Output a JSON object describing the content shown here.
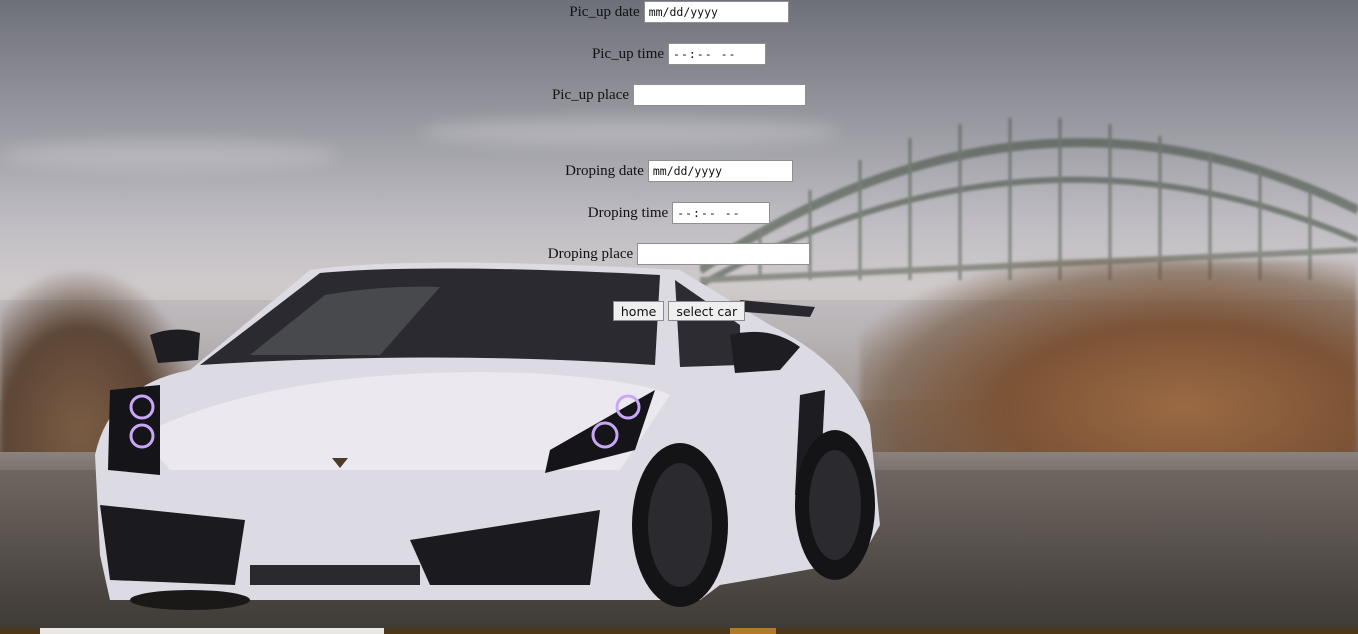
{
  "form": {
    "pickup_date": {
      "label": "Pic_up date",
      "value": "mm/dd/yyyy"
    },
    "pickup_time": {
      "label": "Pic_up time",
      "value": "--:-- --"
    },
    "pickup_place": {
      "label": "Pic_up place",
      "value": ""
    },
    "drop_date": {
      "label": "Droping date",
      "value": "mm/dd/yyyy"
    },
    "drop_time": {
      "label": "Droping time",
      "value": "--:-- --"
    },
    "drop_place": {
      "label": "Droping place",
      "value": ""
    }
  },
  "buttons": {
    "home": "home",
    "select_car": "select car"
  },
  "colors": {
    "car_body": "#e4e2ea",
    "headlight_glow": "#b98cf0",
    "grass": "#8d5f3c"
  }
}
